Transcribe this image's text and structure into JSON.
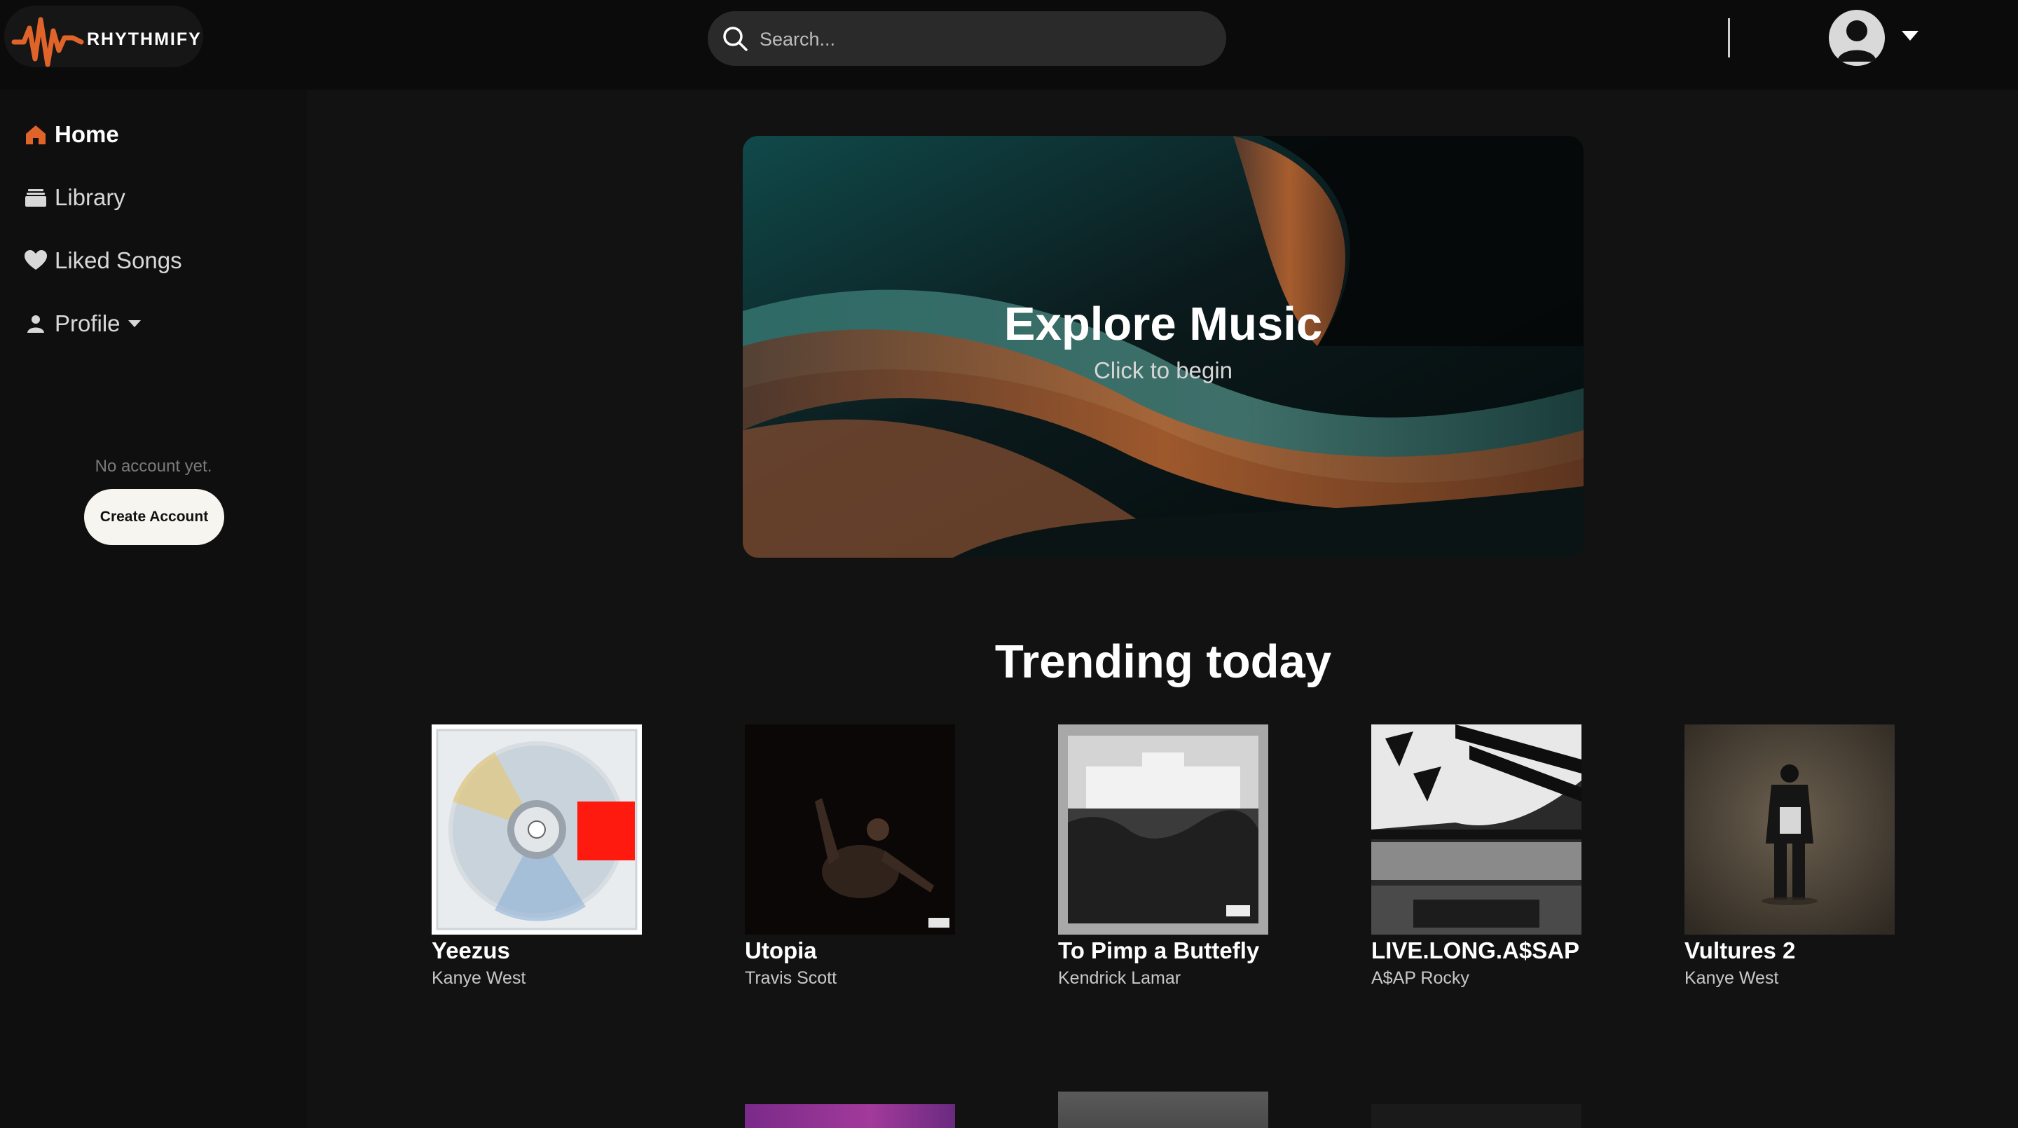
{
  "app": {
    "name": "RHYTHMIFY",
    "logo_icon": "waveform-logo-icon",
    "accent": "#e0642a"
  },
  "search": {
    "placeholder": "Search...",
    "value": ""
  },
  "user": {
    "avatar_icon": "user-avatar-icon",
    "menu_icon": "caret-down-icon"
  },
  "sidebar": {
    "items": [
      {
        "label": "Home",
        "icon": "home-icon",
        "active": true
      },
      {
        "label": "Library",
        "icon": "library-icon",
        "active": false
      },
      {
        "label": "Liked Songs",
        "icon": "heart-icon",
        "active": false
      },
      {
        "label": "Profile",
        "icon": "person-icon",
        "active": false
      }
    ],
    "no_account_text": "No account yet.",
    "create_account_label": "Create Account"
  },
  "hero": {
    "title": "Explore Music",
    "subtitle": "Click to begin"
  },
  "trending": {
    "title": "Trending today",
    "albums": [
      {
        "title": "Yeezus",
        "artist": "Kanye West"
      },
      {
        "title": "Utopia",
        "artist": "Travis Scott"
      },
      {
        "title": "To Pimp a Buttefly",
        "artist": "Kendrick Lamar"
      },
      {
        "title": "LIVE.LONG.A$SAP",
        "artist": "A$AP Rocky"
      },
      {
        "title": "Vultures 2",
        "artist": "Kanye West"
      }
    ]
  }
}
